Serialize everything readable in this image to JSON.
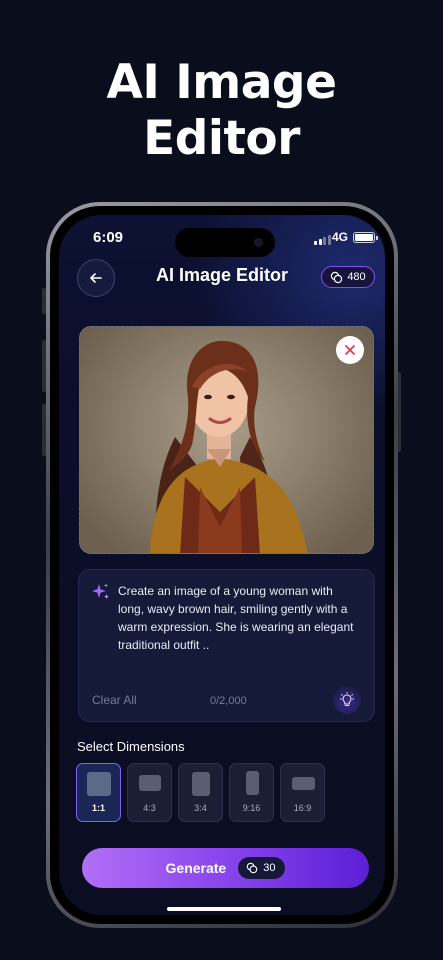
{
  "hero": {
    "line1": "AI Image",
    "line2": "Editor"
  },
  "status": {
    "time": "6:09",
    "network": "4G"
  },
  "header": {
    "title": "AI Image Editor",
    "credits": "480"
  },
  "prompt": {
    "text": "Create an image of a young woman with long, wavy brown hair, smiling gently with a warm expression. She is wearing an elegant traditional outfit ..",
    "clear_label": "Clear All",
    "char_count": "0/2,000"
  },
  "dimensions": {
    "label": "Select Dimensions",
    "options": [
      {
        "label": "1:1",
        "selected": true
      },
      {
        "label": "4:3",
        "selected": false
      },
      {
        "label": "3:4",
        "selected": false
      },
      {
        "label": "9:16",
        "selected": false
      },
      {
        "label": "16:9",
        "selected": false
      }
    ]
  },
  "generate": {
    "label": "Generate",
    "cost": "30"
  },
  "colors": {
    "accent": "#8d48ee",
    "background": "#0a0d1c",
    "card": "#141a38"
  }
}
